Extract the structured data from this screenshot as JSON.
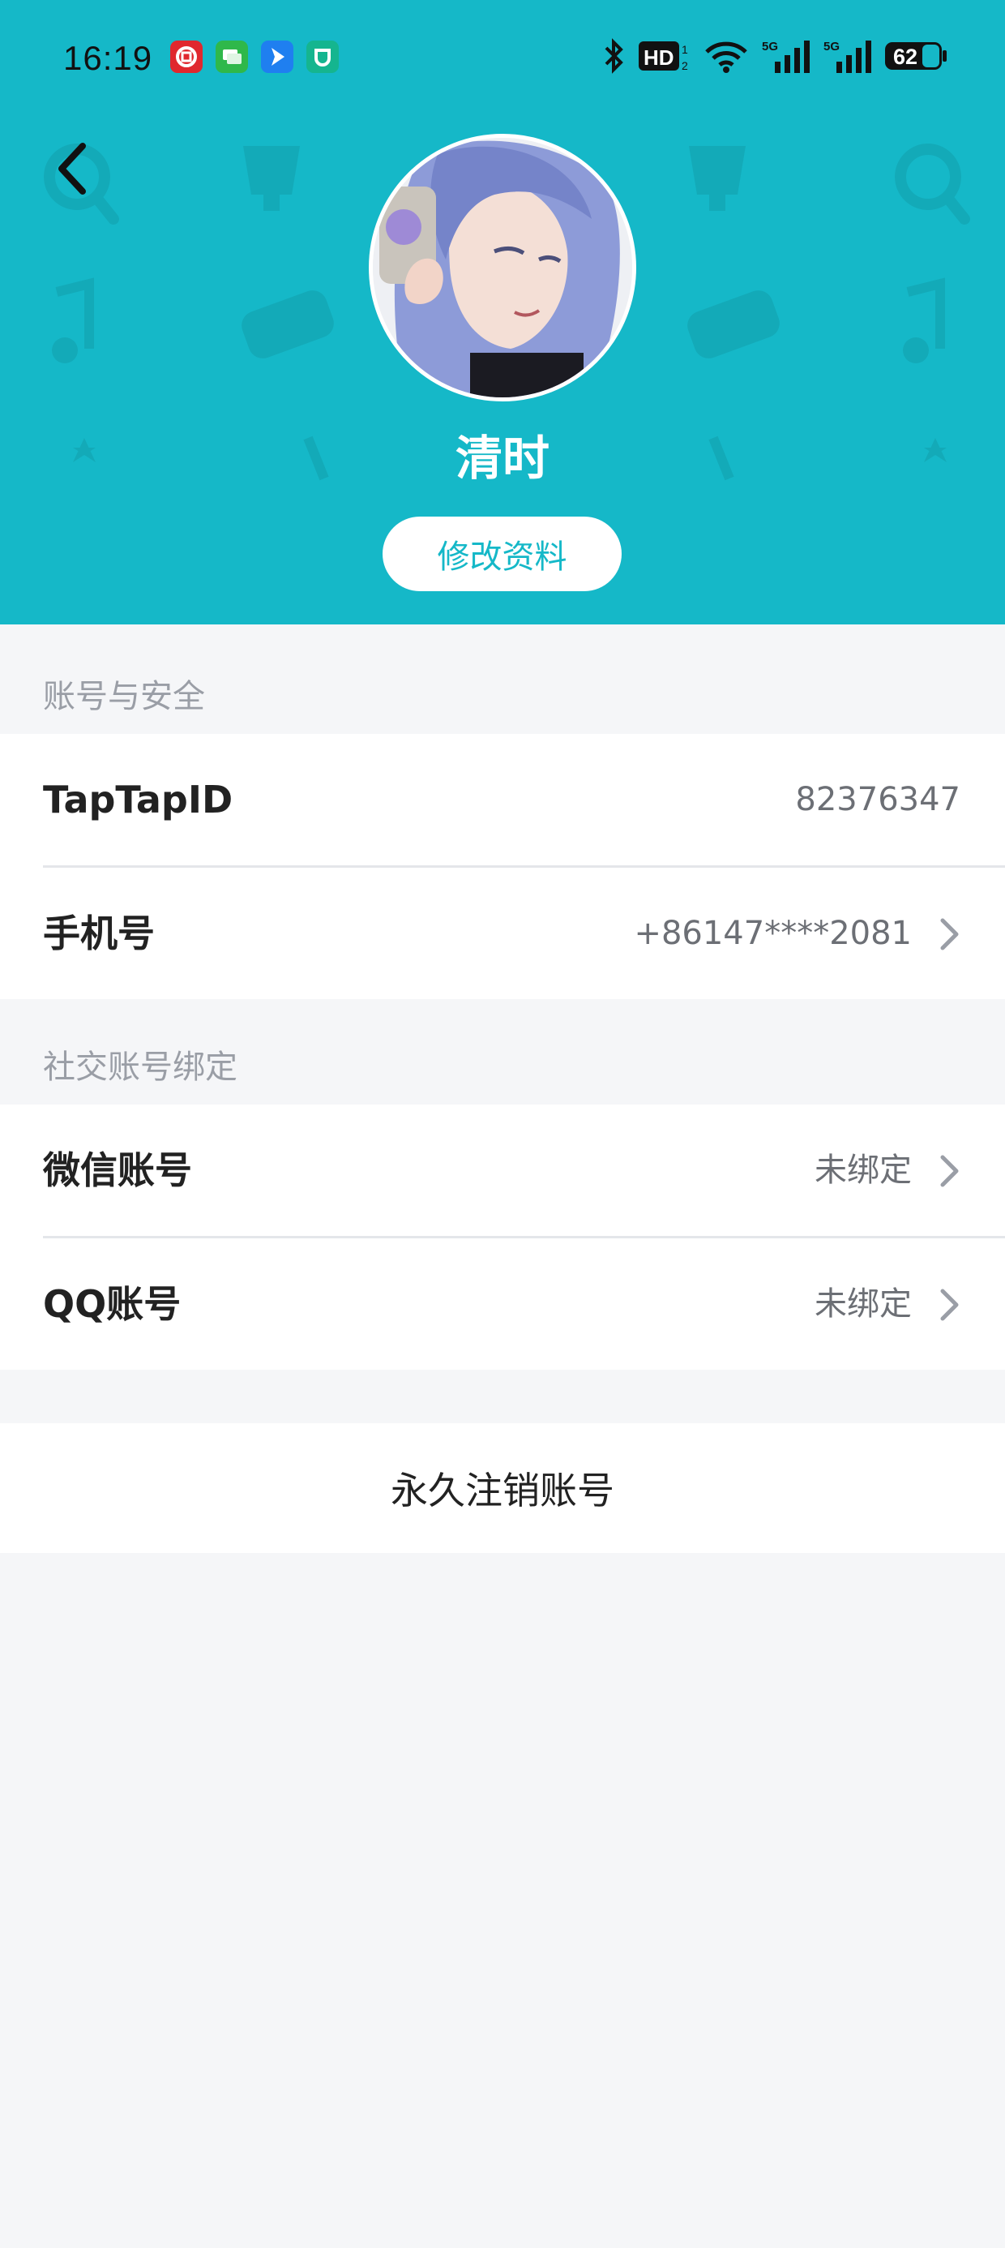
{
  "status_bar": {
    "time": "16:19",
    "notification_icons": [
      "bank-icon",
      "message-icon",
      "navigation-icon",
      "mi-home-icon"
    ],
    "notification_colors": [
      "#e0282e",
      "#2fb84a",
      "#1f7ff0",
      "#15b58f"
    ],
    "right_icons": [
      "bluetooth-icon",
      "hd-icon",
      "wifi-icon",
      "signal-5g-icon",
      "signal-5g-icon",
      "battery-icon"
    ],
    "battery_level": "62"
  },
  "header": {
    "back_icon": "back-arrow-icon",
    "username": "清时",
    "edit_profile_label": "修改资料",
    "background_color": "#15b8c8"
  },
  "account_security": {
    "section_title": "账号与安全",
    "rows": [
      {
        "label": "TapTapID",
        "value": "82376347"
      },
      {
        "label": "手机号",
        "value": "+86147****2081"
      }
    ]
  },
  "social_binding": {
    "section_title": "社交账号绑定",
    "rows": [
      {
        "label": "微信账号",
        "value": "未绑定"
      },
      {
        "label": "QQ账号",
        "value": "未绑定"
      }
    ]
  },
  "delete_account": {
    "label": "永久注销账号"
  }
}
